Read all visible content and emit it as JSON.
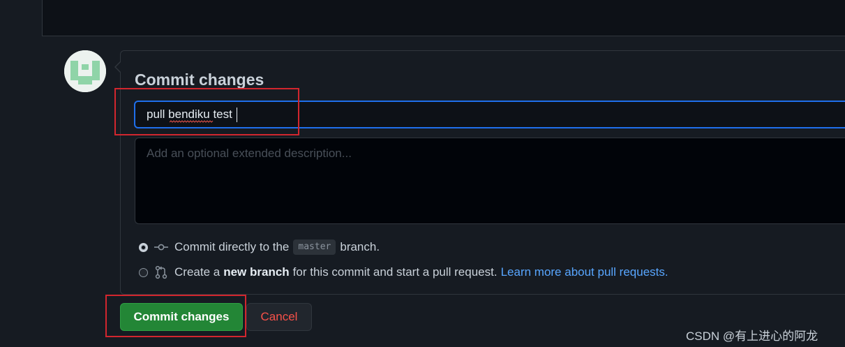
{
  "commit": {
    "title": "Commit changes",
    "summary_value": "pull bendiku test",
    "description_placeholder": "Add an optional extended description...",
    "options": [
      {
        "selected": true,
        "icon": "git-commit-icon",
        "text_before": "Commit directly to the",
        "branch": "master",
        "text_after": "branch."
      },
      {
        "selected": false,
        "icon": "git-pull-request-icon",
        "text_before": "Create a",
        "bold": "new branch",
        "text_after": "for this commit and start a pull request.",
        "link": "Learn more about pull requests."
      }
    ],
    "commit_button": "Commit changes",
    "cancel_button": "Cancel"
  },
  "watermark": "CSDN @有上进心的阿龙",
  "colors": {
    "accent_blue": "#1f6feb",
    "primary_green": "#238636",
    "danger_red": "#f85149",
    "annotation_red": "#d2262e",
    "link_blue": "#58a6ff"
  }
}
